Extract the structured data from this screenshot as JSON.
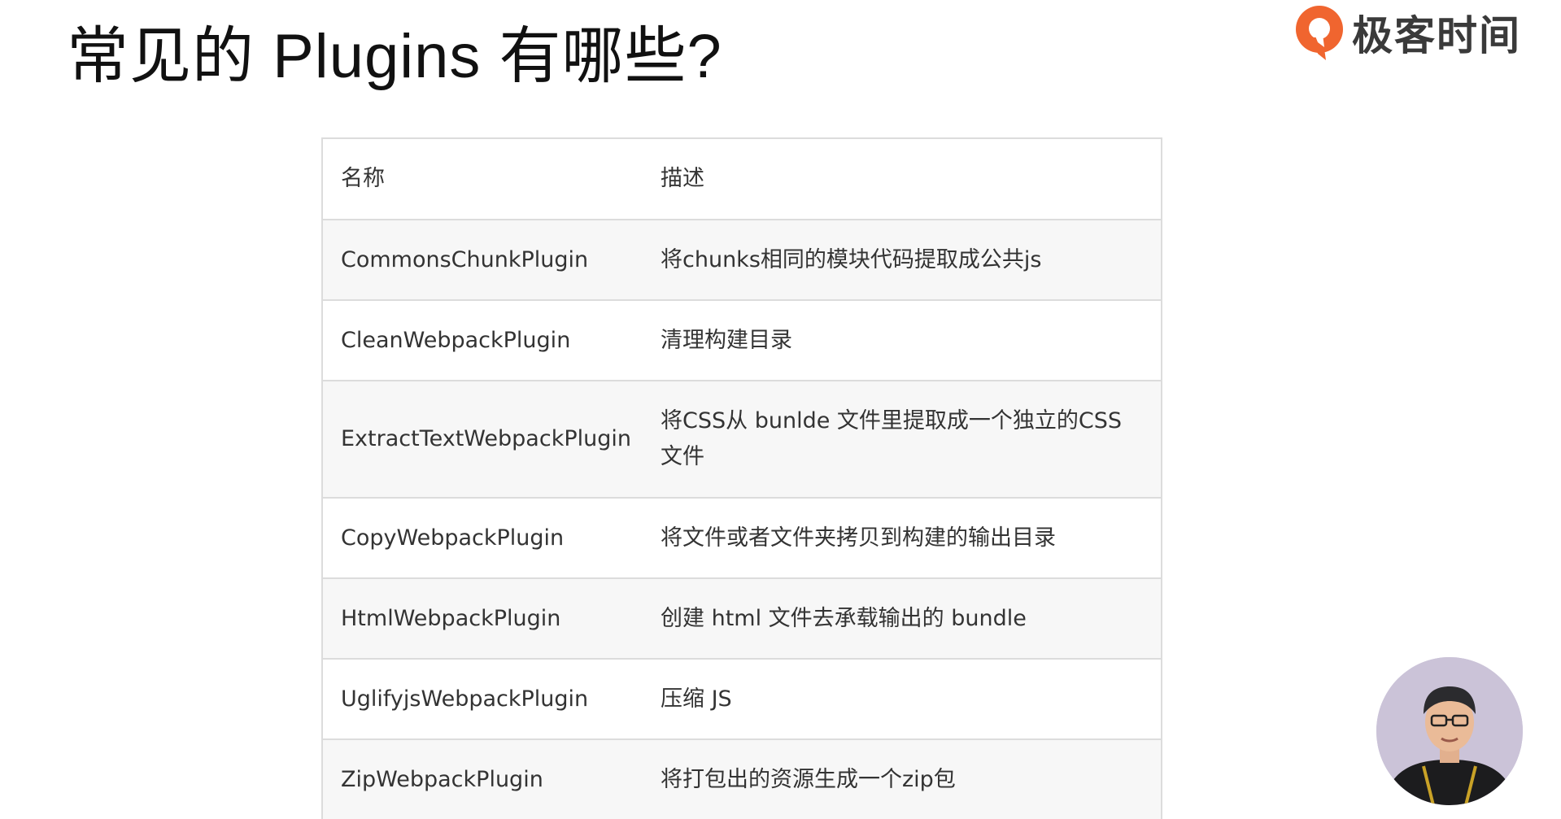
{
  "title": "常见的 Plugins 有哪些?",
  "brand": {
    "logo_icon": "geektime-logo-icon",
    "name": "极客时间",
    "accent_color": "#f0652f"
  },
  "table": {
    "headers": [
      "名称",
      "描述"
    ],
    "rows": [
      {
        "name": "CommonsChunkPlugin",
        "description": "将chunks相同的模块代码提取成公共js"
      },
      {
        "name": "CleanWebpackPlugin",
        "description": "清理构建目录"
      },
      {
        "name": "ExtractTextWebpackPlugin",
        "description": "将CSS从 bunlde 文件里提取成一个独立的CSS文件"
      },
      {
        "name": "CopyWebpackPlugin",
        "description": "将文件或者文件夹拷贝到构建的输出目录"
      },
      {
        "name": "HtmlWebpackPlugin",
        "description": "创建 html 文件去承载输出的 bundle"
      },
      {
        "name": "UglifyjsWebpackPlugin",
        "description": "压缩 JS"
      },
      {
        "name": "ZipWebpackPlugin",
        "description": "将打包出的资源生成一个zip包"
      }
    ]
  },
  "presenter": {
    "icon": "presenter-avatar-icon"
  }
}
